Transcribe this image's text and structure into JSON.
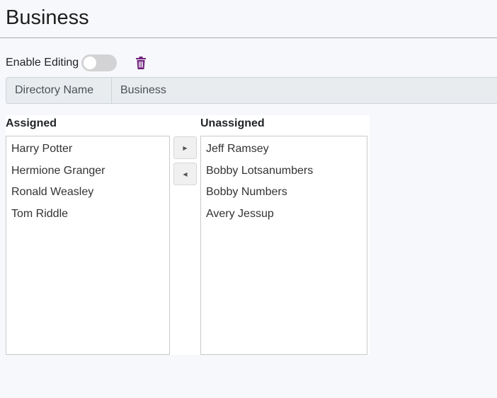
{
  "header": {
    "title": "Business"
  },
  "editing": {
    "label": "Enable Editing",
    "enabled": false
  },
  "directory": {
    "label": "Directory Name",
    "value": "Business"
  },
  "assigned": {
    "header": "Assigned",
    "items": [
      "Harry Potter",
      "Hermione Granger",
      "Ronald Weasley",
      "Tom Riddle"
    ]
  },
  "unassigned": {
    "header": "Unassigned",
    "items": [
      "Jeff Ramsey",
      "Bobby Lotsanumbers",
      "Bobby Numbers",
      "Avery Jessup"
    ]
  },
  "icons": {
    "delete": "trash-icon",
    "move_right": "triangle-right-icon",
    "move_left": "triangle-left-icon"
  },
  "colors": {
    "accent": "#6f1f7a",
    "toggle_off": "#d3d3d5",
    "background": "#f7f8fc"
  }
}
